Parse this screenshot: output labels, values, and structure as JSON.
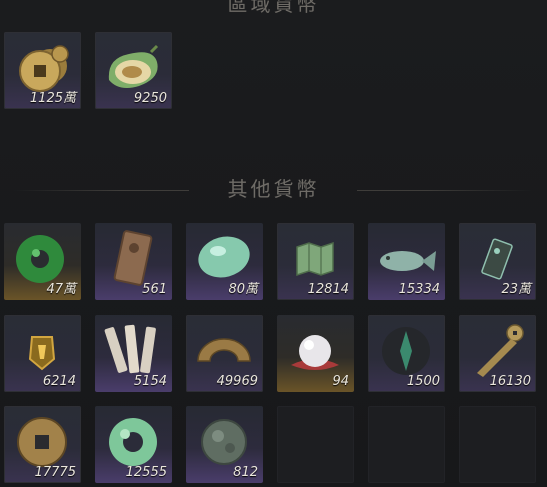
{
  "sections": {
    "top": {
      "title": "區域貨幣"
    },
    "other": {
      "title": "其他貨幣"
    }
  },
  "region_items": [
    {
      "name": "coins-icon",
      "qty": "1125萬"
    },
    {
      "name": "melon-icon",
      "qty": "9250"
    }
  ],
  "other_items": [
    {
      "name": "jade-ring-icon",
      "qty": "47萬"
    },
    {
      "name": "bronze-tablet-icon",
      "qty": "561"
    },
    {
      "name": "jade-stone-icon",
      "qty": "80萬"
    },
    {
      "name": "map-icon",
      "qty": "12814"
    },
    {
      "name": "jade-fish-icon",
      "qty": "15334"
    },
    {
      "name": "token-icon",
      "qty": "23萬"
    },
    {
      "name": "gold-badge-icon",
      "qty": "6214"
    },
    {
      "name": "bamboo-slips-icon",
      "qty": "5154"
    },
    {
      "name": "bronze-half-disc-icon",
      "qty": "49969"
    },
    {
      "name": "pearl-icon",
      "qty": "94"
    },
    {
      "name": "emblem-icon",
      "qty": "1500"
    },
    {
      "name": "knife-coin-icon",
      "qty": "16130"
    },
    {
      "name": "square-hole-coin-icon",
      "qty": "17775"
    },
    {
      "name": "jade-disc-icon",
      "qty": "12555"
    },
    {
      "name": "old-coin-icon",
      "qty": "812"
    }
  ]
}
